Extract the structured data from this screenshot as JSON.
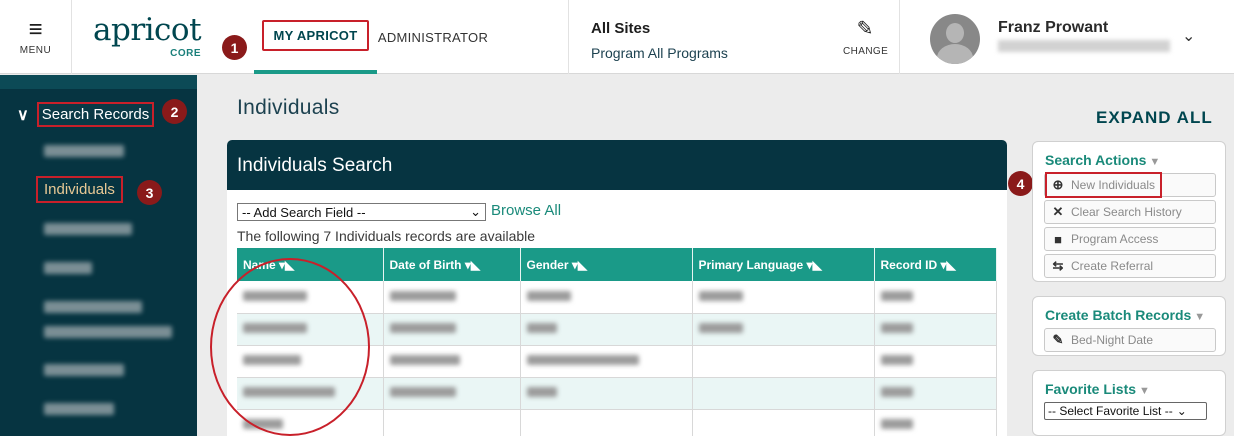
{
  "header": {
    "menu_label": "MENU",
    "logo_main": "apricot",
    "logo_sub": "CORE",
    "tabs": [
      {
        "label": "MY APRICOT"
      },
      {
        "label": "ADMINISTRATOR"
      }
    ],
    "site_title": "All Sites",
    "program": "Program All Programs",
    "change_label": "CHANGE",
    "user_name": "Franz Prowant"
  },
  "sidebar": {
    "section_label": "Search Records",
    "active_item": "Individuals"
  },
  "markers": [
    "1",
    "2",
    "3",
    "4"
  ],
  "main": {
    "page_title": "Individuals",
    "expand_all": "EXPAND ALL",
    "panel_title": "Individuals Search",
    "add_field_placeholder": "-- Add Search Field --",
    "browse_all": "Browse All",
    "available_text": "The following 7 Individuals records are available",
    "columns": [
      "Name",
      "Date of Birth",
      "Gender",
      "Primary Language",
      "Record ID"
    ]
  },
  "actions": {
    "title": "Search Actions",
    "new_individuals": "New Individuals",
    "clear_history": "Clear Search History",
    "program_access": "Program Access",
    "create_referral": "Create Referral"
  },
  "batch": {
    "title": "Create Batch Records",
    "bed_night": "Bed-Night Date"
  },
  "favorites": {
    "title": "Favorite Lists",
    "select": "-- Select Favorite List --"
  },
  "colors": {
    "brand_dark": "#063441",
    "accent_teal": "#1a9a88",
    "annotation_red": "#c8202a"
  },
  "icons": [
    "menu-icon",
    "pencil-icon",
    "avatar-icon",
    "chevron-down-icon",
    "plus-circle-icon",
    "x-icon",
    "lock-icon",
    "swap-icon",
    "triangle-down-icon"
  ]
}
